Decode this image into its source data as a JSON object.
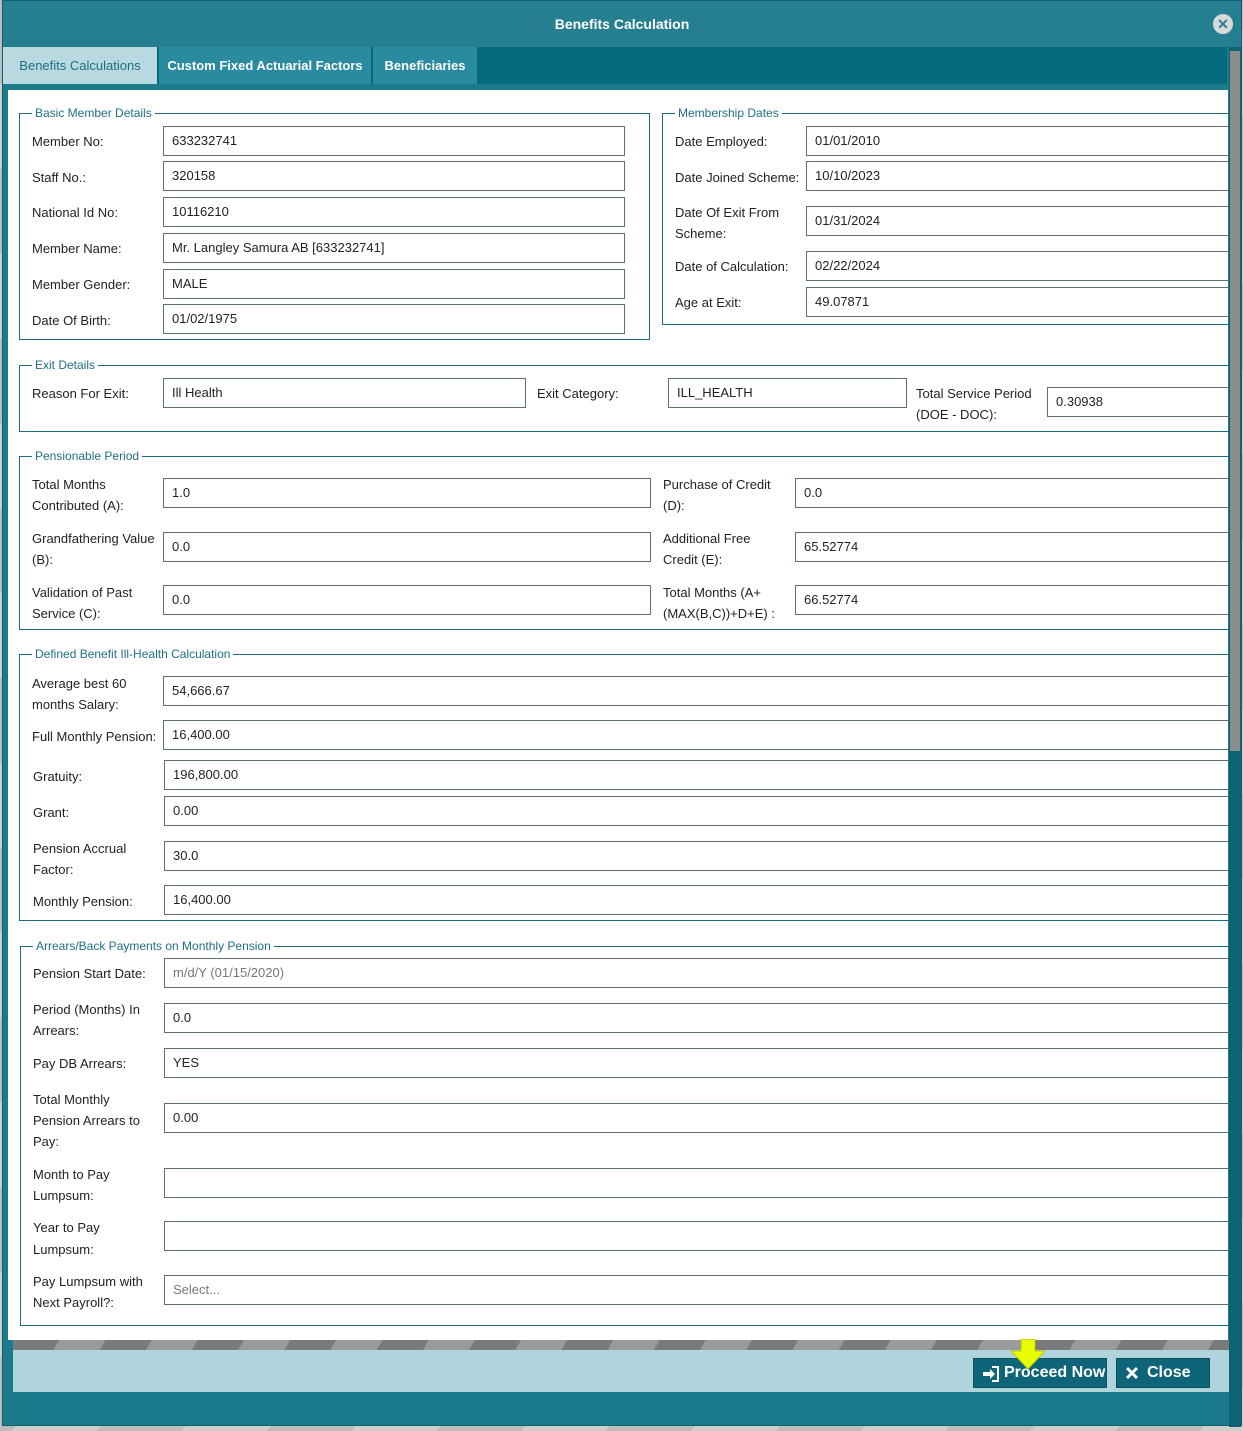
{
  "window": {
    "title": "Benefits Calculation"
  },
  "tabs": [
    {
      "label": "Benefits Calculations"
    },
    {
      "label": "Custom Fixed Actuarial Factors"
    },
    {
      "label": "Beneficiaries"
    }
  ],
  "basic": {
    "legend": "Basic Member Details",
    "member_no_label": "Member No:",
    "member_no": "633232741",
    "staff_no_label": "Staff No.:",
    "staff_no": "320158",
    "national_id_label": "National Id No:",
    "national_id": "10116210",
    "member_name_label": "Member Name:",
    "member_name": "Mr. Langley Samura AB [633232741]",
    "gender_label": "Member Gender:",
    "gender": "MALE",
    "dob_label": "Date Of Birth:",
    "dob": "01/02/1975"
  },
  "dates": {
    "legend": "Membership Dates",
    "employed_label": "Date Employed:",
    "employed": "01/01/2010",
    "joined_label": "Date Joined Scheme:",
    "joined": "10/10/2023",
    "exit_label_1": "Date Of Exit From",
    "exit_label_2": "Scheme:",
    "exit": "01/31/2024",
    "calc_label": "Date of Calculation:",
    "calc": "02/22/2024",
    "age_label": "Age at Exit:",
    "age": "49.07871"
  },
  "exit": {
    "legend": "Exit Details",
    "reason_label": "Reason For Exit:",
    "reason": "Ill Health",
    "category_label": "Exit Category:",
    "category": "ILL_HEALTH",
    "service_label_1": "Total Service Period",
    "service_label_2": "(DOE - DOC):",
    "service": "0.30938"
  },
  "pensionable": {
    "legend": "Pensionable Period",
    "a_label_1": "Total Months",
    "a_label_2": "Contributed (A):",
    "a": "1.0",
    "b_label_1": "Grandfathering Value",
    "b_label_2": "(B):",
    "b": "0.0",
    "c_label_1": "Validation of Past",
    "c_label_2": "Service (C):",
    "c": "0.0",
    "d_label_1": "Purchase of Credit",
    "d_label_2": "(D):",
    "d": "0.0",
    "e_label_1": "Additional Free",
    "e_label_2": "Credit (E):",
    "e": "65.52774",
    "t_label_1": "Total Months (A+",
    "t_label_2": "(MAX(B,C))+D+E) :",
    "t": "66.52774"
  },
  "db": {
    "legend": "Defined Benefit Ill-Health Calculation",
    "avg_label_1": "Average best 60",
    "avg_label_2": "months Salary:",
    "avg": "54,666.67",
    "full_label": "Full Monthly Pension:",
    "full": "16,400.00",
    "gratuity_label": "Gratuity:",
    "gratuity": "196,800.00",
    "grant_label": "Grant:",
    "grant": "0.00",
    "accrual_label_1": "Pension Accrual",
    "accrual_label_2": "Factor:",
    "accrual": "30.0",
    "monthly_label": "Monthly Pension:",
    "monthly": "16,400.00"
  },
  "arrears": {
    "legend": "Arrears/Back Payments on Monthly Pension",
    "start_label": "Pension Start Date:",
    "start_placeholder": "m/d/Y (01/15/2020)",
    "period_label_1": "Period (Months) In",
    "period_label_2": "Arrears:",
    "period": "0.0",
    "pay_db_label": "Pay DB Arrears:",
    "pay_db": "YES",
    "total_label_1": "Total Monthly",
    "total_label_2": "Pension Arrears to",
    "total_label_3": "Pay:",
    "total": "0.00",
    "month_label_1": "Month to Pay",
    "month_label_2": "Lumpsum:",
    "month": "",
    "year_label_1": "Year to Pay",
    "year_label_2": "Lumpsum:",
    "year": "",
    "next_label_1": "Pay Lumpsum with",
    "next_label_2": "Next Payroll?:",
    "next_placeholder": "Select..."
  },
  "buttons": {
    "proceed": "Proceed Now",
    "close": "Close"
  },
  "colors": {
    "header": "#257f91",
    "tab_bar": "#046a7e",
    "accent": "#1f6f83",
    "button": "#0e6579",
    "highlight_arrow": "#e8ff00"
  }
}
